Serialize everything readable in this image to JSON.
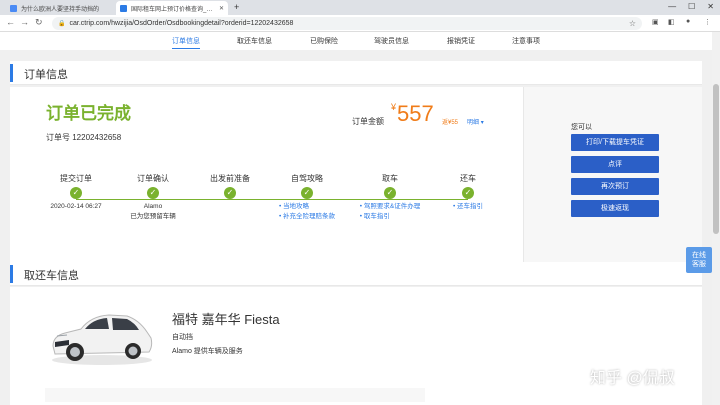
{
  "browser": {
    "tabs": [
      {
        "label": "为什么欧洲人要坚持手动挡的",
        "fav_color": "#4a8af4"
      },
      {
        "label": "国际租车网上预订价格查询_国际",
        "fav_color": "#2c7be5"
      }
    ],
    "new_tab": "+",
    "url": "car.ctrip.com/hwzijia/OsdOrder/Osdbookingdetail?orderid=12202432658",
    "window_controls": [
      "—",
      "☐",
      "✕"
    ]
  },
  "subnav": {
    "items": [
      "订单信息",
      "取还车信息",
      "已购保险",
      "驾驶员信息",
      "报销凭证",
      "注意事项"
    ]
  },
  "order_section": {
    "title": "订单信息",
    "status": "订单已完成",
    "order_number": "订单号 12202432658",
    "amount_label": "订单金额",
    "currency": "¥",
    "amount": "557",
    "amount_sub": "返¥55",
    "detail_link": "明细",
    "steps": [
      {
        "name": "提交订单",
        "info": [
          "2020-02-14 06:27"
        ],
        "links": []
      },
      {
        "name": "订单确认",
        "info": [
          "Alamo",
          "已为您预留车辆"
        ],
        "links": []
      },
      {
        "name": "出发前准备",
        "info": [],
        "links": []
      },
      {
        "name": "自驾攻略",
        "info": [],
        "links": [
          "当地攻略",
          "补充全险理赔条款"
        ]
      },
      {
        "name": "取车",
        "info": [],
        "links": [
          "驾照要求&证件办理",
          "取车指引"
        ]
      },
      {
        "name": "还车",
        "info": [],
        "links": [
          "还车指引"
        ]
      }
    ],
    "side": {
      "label": "您可以",
      "buttons": [
        "打印/下载提车凭证",
        "点评",
        "再次预订",
        "极速返现"
      ]
    }
  },
  "float_service": [
    "在线",
    "客服"
  ],
  "car_section": {
    "title": "取还车信息",
    "car_name": "福特 嘉年华 Fiesta",
    "transmission": "自动挡",
    "vendor": "Alamo 提供车辆及服务"
  },
  "watermark": "知乎 @侃叔",
  "colors": {
    "accent": "#2c7be5",
    "success": "#7ab22e",
    "price": "#f07c19",
    "button": "#2b5fc7"
  }
}
